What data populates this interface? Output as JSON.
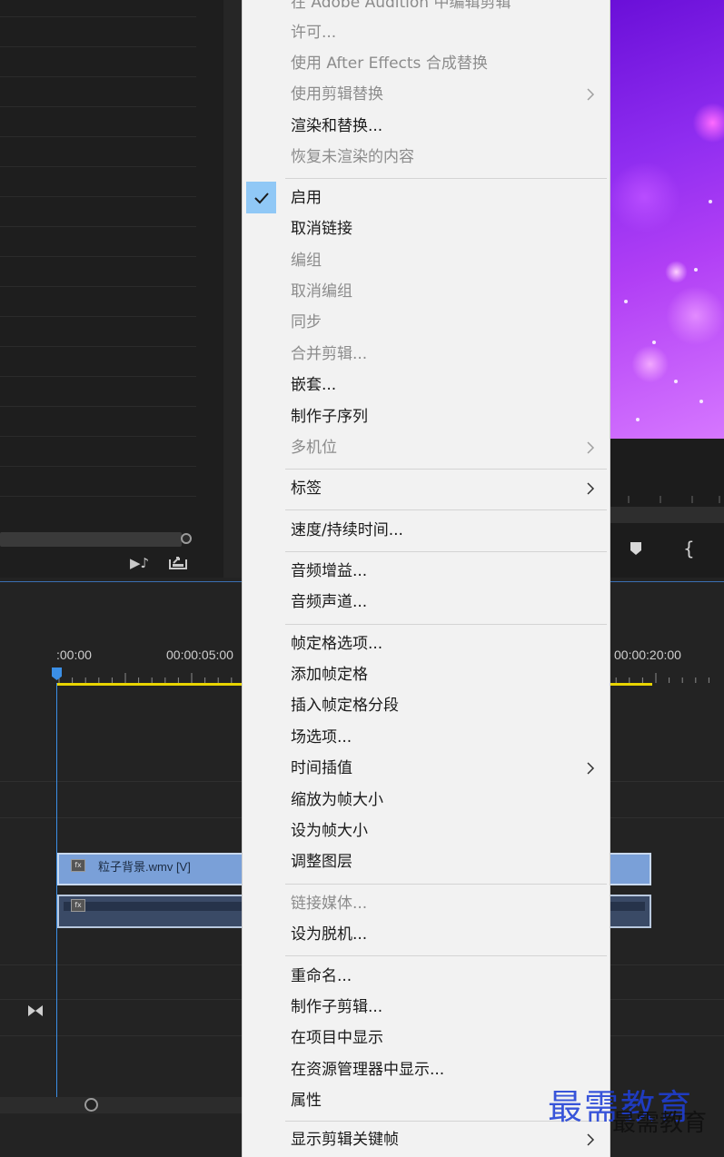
{
  "timeline": {
    "timecodes": [
      ":00:00",
      "00:00:05:00",
      "00:00:20:00"
    ],
    "clip_label": "粒子背景.wmv [V]",
    "fx_label": "fx"
  },
  "context_menu": {
    "items": [
      {
        "label": "在 Adobe Audition 中编辑剪辑",
        "enabled": false,
        "submenu": false
      },
      {
        "label": "许可...",
        "enabled": false,
        "submenu": false
      },
      {
        "label": "使用 After Effects 合成替换",
        "enabled": false,
        "submenu": false
      },
      {
        "label": "使用剪辑替换",
        "enabled": false,
        "submenu": true
      },
      {
        "label": "渲染和替换...",
        "enabled": true,
        "submenu": false
      },
      {
        "label": "恢复未渲染的内容",
        "enabled": false,
        "submenu": false
      },
      {
        "label": "启用",
        "enabled": true,
        "submenu": false,
        "checked": true
      },
      {
        "label": "取消链接",
        "enabled": true,
        "submenu": false
      },
      {
        "label": "编组",
        "enabled": false,
        "submenu": false
      },
      {
        "label": "取消编组",
        "enabled": false,
        "submenu": false
      },
      {
        "label": "同步",
        "enabled": false,
        "submenu": false
      },
      {
        "label": "合并剪辑...",
        "enabled": false,
        "submenu": false
      },
      {
        "label": "嵌套...",
        "enabled": true,
        "submenu": false
      },
      {
        "label": "制作子序列",
        "enabled": true,
        "submenu": false
      },
      {
        "label": "多机位",
        "enabled": false,
        "submenu": true
      },
      {
        "label": "标签",
        "enabled": true,
        "submenu": true
      },
      {
        "label": "速度/持续时间...",
        "enabled": true,
        "submenu": false
      },
      {
        "label": "音频增益...",
        "enabled": true,
        "submenu": false
      },
      {
        "label": "音频声道...",
        "enabled": true,
        "submenu": false
      },
      {
        "label": "帧定格选项...",
        "enabled": true,
        "submenu": false
      },
      {
        "label": "添加帧定格",
        "enabled": true,
        "submenu": false
      },
      {
        "label": "插入帧定格分段",
        "enabled": true,
        "submenu": false
      },
      {
        "label": "场选项...",
        "enabled": true,
        "submenu": false
      },
      {
        "label": "时间插值",
        "enabled": true,
        "submenu": true
      },
      {
        "label": "缩放为帧大小",
        "enabled": true,
        "submenu": false
      },
      {
        "label": "设为帧大小",
        "enabled": true,
        "submenu": false
      },
      {
        "label": "调整图层",
        "enabled": true,
        "submenu": false
      },
      {
        "label": "链接媒体...",
        "enabled": false,
        "submenu": false
      },
      {
        "label": "设为脱机...",
        "enabled": true,
        "submenu": false
      },
      {
        "label": "重命名...",
        "enabled": true,
        "submenu": false
      },
      {
        "label": "制作子剪辑...",
        "enabled": true,
        "submenu": false
      },
      {
        "label": "在项目中显示",
        "enabled": true,
        "submenu": false
      },
      {
        "label": "在资源管理器中显示...",
        "enabled": true,
        "submenu": false
      },
      {
        "label": "属性",
        "enabled": true,
        "submenu": false
      },
      {
        "label": "显示剪辑关键帧",
        "enabled": true,
        "submenu": true
      }
    ]
  },
  "watermark": {
    "main": "最需教育",
    "sub": "最需教育"
  },
  "icons": {
    "check": "check-icon",
    "submenu": "chevron-right-icon",
    "audio": "audio-note-icon",
    "export": "export-frame-icon",
    "marker": "marker-icon",
    "bracket": "in-point-bracket-icon",
    "bowtie": "snap-bowtie-icon"
  }
}
